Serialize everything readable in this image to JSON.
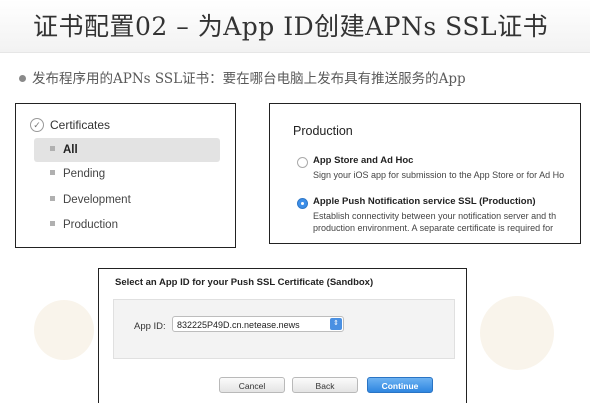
{
  "slide": {
    "title": "证书配置02  –  为App ID创建APNs SSL证书",
    "bullet": "发布程序用的APNs SSL证书：要在哪台电脑上发布具有推送服务的App"
  },
  "certificates_panel": {
    "header": "Certificates",
    "header_icon": "certificate-icon",
    "items": [
      {
        "label": "All",
        "selected": true
      },
      {
        "label": "Pending",
        "selected": false
      },
      {
        "label": "Development",
        "selected": false
      },
      {
        "label": "Production",
        "selected": false
      }
    ]
  },
  "production_panel": {
    "title": "Production",
    "options": [
      {
        "title": "App Store and Ad Hoc",
        "description": "Sign your iOS app for submission to the App Store or for Ad Ho",
        "checked": false
      },
      {
        "title": "Apple Push Notification service SSL (Production)",
        "description": "Establish connectivity between your notification server and th",
        "description2": "production environment. A separate certificate is required for",
        "checked": true
      }
    ]
  },
  "app_id_panel": {
    "header": "Select an App ID for your Push SSL Certificate (Sandbox)",
    "label": "App ID:",
    "selected_value": "832225P49D.cn.netease.news",
    "buttons": {
      "cancel": "Cancel",
      "back": "Back",
      "continue": "Continue"
    }
  },
  "colors": {
    "accent": "#3c8ee8",
    "selected_item_bg": "#e3e3e3"
  }
}
